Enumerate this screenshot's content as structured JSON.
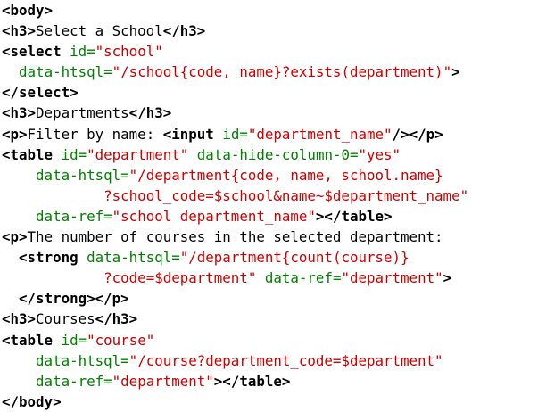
{
  "colors": {
    "tag": "#000000",
    "attribute": "#008000",
    "value": "#cc0000",
    "text": "#000000",
    "background": "#ffffff"
  },
  "code_lines": [
    [
      [
        "tag",
        "<body>"
      ]
    ],
    [
      [
        "tag",
        "<h3>"
      ],
      [
        "text",
        "Select a School"
      ],
      [
        "tag",
        "</h3>"
      ]
    ],
    [
      [
        "tag",
        "<select"
      ],
      [
        "text",
        " "
      ],
      [
        "attr",
        "id="
      ],
      [
        "val",
        "\"school\""
      ]
    ],
    [
      [
        "text",
        "  "
      ],
      [
        "attr",
        "data-htsql="
      ],
      [
        "val",
        "\"/school{code, name}?exists(department)\""
      ],
      [
        "tag",
        ">"
      ]
    ],
    [
      [
        "tag",
        "</select>"
      ]
    ],
    [
      [
        "tag",
        "<h3>"
      ],
      [
        "text",
        "Departments"
      ],
      [
        "tag",
        "</h3>"
      ]
    ],
    [
      [
        "tag",
        "<p>"
      ],
      [
        "text",
        "Filter by name: "
      ],
      [
        "tag",
        "<input"
      ],
      [
        "text",
        " "
      ],
      [
        "attr",
        "id="
      ],
      [
        "val",
        "\"department_name\""
      ],
      [
        "tag",
        "/></p>"
      ]
    ],
    [
      [
        "tag",
        "<table"
      ],
      [
        "text",
        " "
      ],
      [
        "attr",
        "id="
      ],
      [
        "val",
        "\"department\""
      ],
      [
        "text",
        " "
      ],
      [
        "attr",
        "data-hide-column-0="
      ],
      [
        "val",
        "\"yes\""
      ]
    ],
    [
      [
        "text",
        "    "
      ],
      [
        "attr",
        "data-htsql="
      ],
      [
        "val",
        "\"/department{code, name, school.name}"
      ]
    ],
    [
      [
        "text",
        "            "
      ],
      [
        "val",
        "?school_code=$school&name~$department_name\""
      ]
    ],
    [
      [
        "text",
        "    "
      ],
      [
        "attr",
        "data-ref="
      ],
      [
        "val",
        "\"school department_name\""
      ],
      [
        "tag",
        "></table>"
      ]
    ],
    [
      [
        "tag",
        "<p>"
      ],
      [
        "text",
        "The number of courses in the selected department:"
      ]
    ],
    [
      [
        "text",
        "  "
      ],
      [
        "tag",
        "<strong"
      ],
      [
        "text",
        " "
      ],
      [
        "attr",
        "data-htsql="
      ],
      [
        "val",
        "\"/department{count(course)}"
      ]
    ],
    [
      [
        "text",
        "            "
      ],
      [
        "val",
        "?code=$department\""
      ],
      [
        "text",
        " "
      ],
      [
        "attr",
        "data-ref="
      ],
      [
        "val",
        "\"department\""
      ],
      [
        "tag",
        ">"
      ]
    ],
    [
      [
        "text",
        "  "
      ],
      [
        "tag",
        "</strong></p>"
      ]
    ],
    [
      [
        "tag",
        "<h3>"
      ],
      [
        "text",
        "Courses"
      ],
      [
        "tag",
        "</h3>"
      ]
    ],
    [
      [
        "tag",
        "<table"
      ],
      [
        "text",
        " "
      ],
      [
        "attr",
        "id="
      ],
      [
        "val",
        "\"course\""
      ]
    ],
    [
      [
        "text",
        "    "
      ],
      [
        "attr",
        "data-htsql="
      ],
      [
        "val",
        "\"/course?department_code=$department\""
      ]
    ],
    [
      [
        "text",
        "    "
      ],
      [
        "attr",
        "data-ref="
      ],
      [
        "val",
        "\"department\""
      ],
      [
        "tag",
        "></table>"
      ]
    ],
    [
      [
        "tag",
        "</body>"
      ]
    ]
  ]
}
